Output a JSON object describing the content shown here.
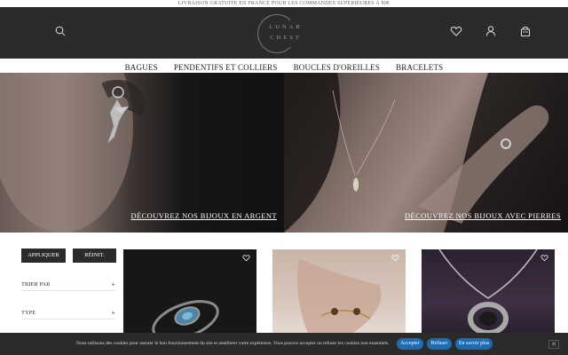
{
  "announcement": "LIVRAISON GRATUITE EN FRANCE POUR LES COMMANDES SUPÉRIEURES À 80€",
  "logo": {
    "line1": "LUNAR",
    "line2": "CHEST"
  },
  "header_icons": [
    "search-icon",
    "heart-icon",
    "user-icon",
    "cart-icon"
  ],
  "nav": [
    "BAGUES",
    "PENDENTIFS ET COLLIERS",
    "BOUCLES D'OREILLES",
    "BRACELETS"
  ],
  "hero": {
    "left_cta": "DÉCOUVREZ NOS BIJOUX EN ARGENT",
    "right_cta": "DÉCOUVREZ NOS BIJOUX AVEC PIERRES"
  },
  "filters": {
    "apply": "APPLIQUER",
    "reset": "RÉINIT.",
    "rows": [
      {
        "label": "TRIER PAR",
        "toggle": "+"
      },
      {
        "label": "TYPE",
        "toggle": "+"
      }
    ]
  },
  "cookie": {
    "message": "Nous utilisons des cookies pour assurer le bon fonctionnement du site et améliorer votre expérience. Vous pouvez accepter ou refuser les cookies non essentiels.",
    "accept": "Accepter",
    "refuse": "Refuser",
    "more": "En savoir plus",
    "close": "✕"
  },
  "colors": {
    "header": "#2b2b2b",
    "cookie_button": "#1e6bb0"
  }
}
